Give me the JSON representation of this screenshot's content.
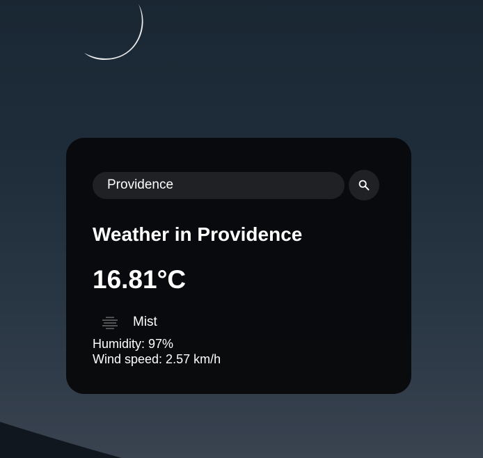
{
  "background": {
    "sky_top_color": "#1a2733",
    "sky_bottom_color": "#3a4350",
    "moon_color": "#e8e8e8"
  },
  "search": {
    "value": "Providence",
    "placeholder": "Search",
    "button_icon": "search-icon"
  },
  "weather": {
    "title": "Weather in Providence",
    "temperature": "16.81°C",
    "condition_icon": "mist-icon",
    "description": "Mist",
    "humidity": "Humidity: 97%",
    "wind": "Wind speed: 2.57 km/h"
  }
}
